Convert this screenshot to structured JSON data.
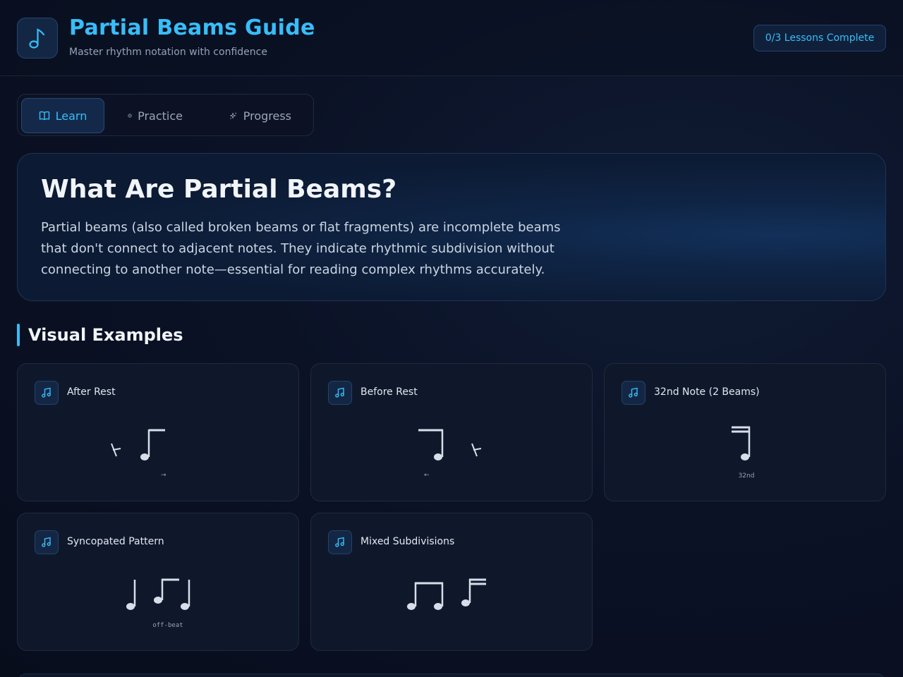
{
  "header": {
    "title": "Partial Beams Guide",
    "subtitle": "Master rhythm notation with confidence",
    "logo_icon": "music-note-icon",
    "progress_badge": "0/3 Lessons Complete"
  },
  "tabs": [
    {
      "label": "Learn",
      "icon": "book-open-icon",
      "active": true
    },
    {
      "label": "Practice",
      "icon": "target-icon",
      "active": false
    },
    {
      "label": "Progress",
      "icon": "sparkles-icon",
      "active": false
    }
  ],
  "intro": {
    "title": "What Are Partial Beams?",
    "text": "Partial beams (also called broken beams or flat fragments) are incomplete beams that don't connect to adjacent notes. They indicate rhythmic subdivision without connecting to another note—essential for reading complex rhythms accurately."
  },
  "examples_section": {
    "title": "Visual Examples",
    "cards": [
      {
        "title": "After Rest",
        "icon": "music-notes-icon",
        "caption": "→"
      },
      {
        "title": "Before Rest",
        "icon": "music-notes-icon",
        "caption": "←"
      },
      {
        "title": "32nd Note (2 Beams)",
        "icon": "music-notes-icon",
        "caption": "32nd"
      },
      {
        "title": "Syncopated Pattern",
        "icon": "music-notes-icon",
        "caption": "off-beat"
      },
      {
        "title": "Mixed Subdivisions",
        "icon": "music-notes-icon",
        "caption": ""
      }
    ]
  },
  "colors": {
    "accent": "#38bdf8",
    "background": "#0b1226",
    "card": "#0f182b",
    "note": "#d8dee9"
  }
}
